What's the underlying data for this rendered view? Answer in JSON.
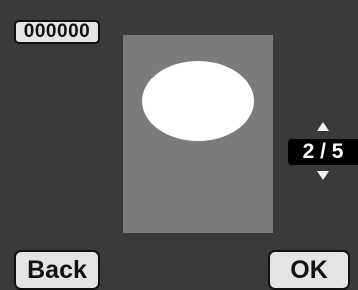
{
  "header": {
    "counter_label": "000000"
  },
  "preview": {
    "shape": "ellipse"
  },
  "navigation": {
    "page_indicator": "2 / 5",
    "up_icon": "triangle-up-icon",
    "down_icon": "triangle-down-icon"
  },
  "footer": {
    "back_label": "Back",
    "ok_label": "OK"
  },
  "colors": {
    "background": "#3a3a3a",
    "preview_fill": "#7b7b7b",
    "shape_fill": "#ffffff",
    "button_fill": "#e4e4e4",
    "indicator_fill": "#000000"
  }
}
